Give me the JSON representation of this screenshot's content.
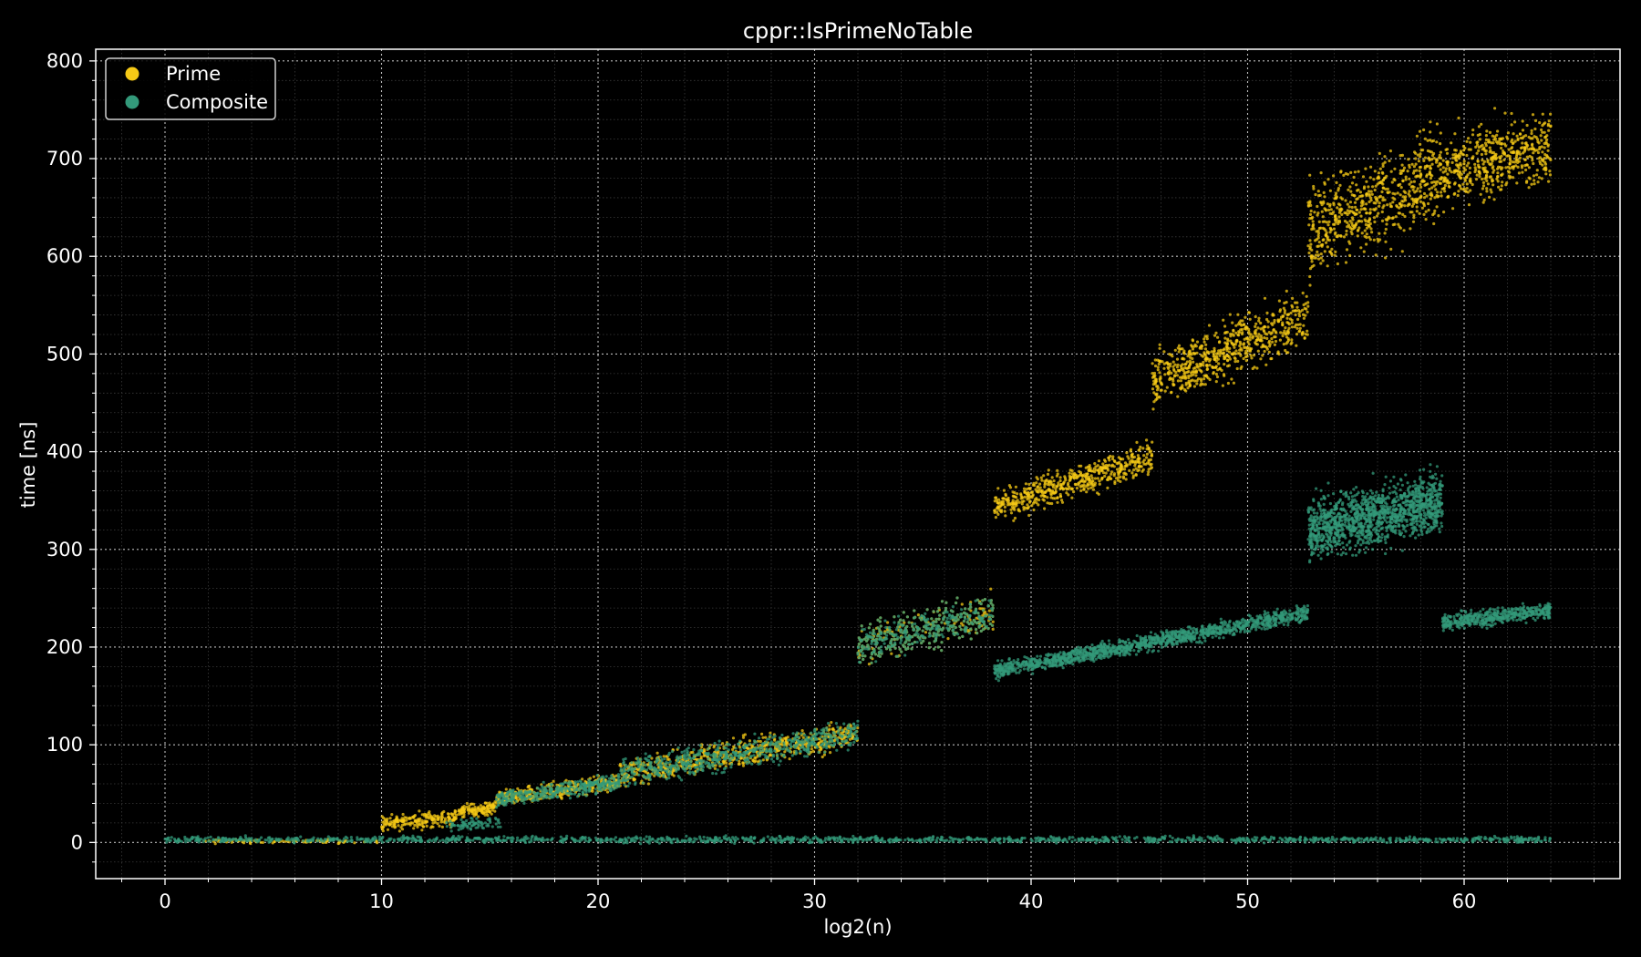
{
  "chart_data": {
    "type": "scatter",
    "title": "cppr::IsPrimeNoTable",
    "xlabel": "log2(n)",
    "ylabel": "time [ns]",
    "xlim": [
      -3.2,
      67.2
    ],
    "ylim": [
      -37,
      812
    ],
    "x_ticks": [
      0,
      10,
      20,
      30,
      40,
      50,
      60
    ],
    "y_ticks": [
      0,
      100,
      200,
      300,
      400,
      500,
      600,
      700,
      800
    ],
    "grid": true,
    "minor_grid": true,
    "legend_position": "top-left",
    "background": "#000000",
    "series": [
      {
        "name": "Prime",
        "color": "#f5c916",
        "bands": [
          {
            "x": [
              1.5,
              10
            ],
            "y": [
              1,
              1
            ],
            "spread": 1,
            "points": 80
          },
          {
            "x": [
              10,
              13.5
            ],
            "y": [
              20,
              25
            ],
            "spread": 4,
            "points": 200
          },
          {
            "x": [
              13.5,
              15.3
            ],
            "y": [
              32,
              36
            ],
            "spread": 3,
            "points": 120
          },
          {
            "x": [
              15.3,
              21
            ],
            "y": [
              44,
              62
            ],
            "spread": 4,
            "points": 350
          },
          {
            "x": [
              21,
              32
            ],
            "y": [
              70,
              112
            ],
            "spread": 7,
            "points": 650
          },
          {
            "x": [
              32,
              38.3
            ],
            "y": [
              202,
              236
            ],
            "spread": 10,
            "points": 400
          },
          {
            "x": [
              38.3,
              45.6
            ],
            "y": [
              342,
              395
            ],
            "spread": 8,
            "points": 550
          },
          {
            "x": [
              45.6,
              52.8
            ],
            "y": [
              470,
              540
            ],
            "spread": 14,
            "points": 650
          },
          {
            "x": [
              52.8,
              59
            ],
            "y": [
              625,
              685
            ],
            "spread": 22,
            "points": 650
          },
          {
            "x": [
              59,
              64
            ],
            "y": [
              685,
              715
            ],
            "spread": 18,
            "points": 500
          }
        ]
      },
      {
        "name": "Composite",
        "color": "#33997a",
        "bands": [
          {
            "x": [
              0,
              64
            ],
            "y": [
              3,
              3
            ],
            "spread": 1.5,
            "points": 1400
          },
          {
            "x": [
              13,
              15.5
            ],
            "y": [
              17,
              20
            ],
            "spread": 3,
            "points": 80
          },
          {
            "x": [
              15.3,
              21
            ],
            "y": [
              44,
              62
            ],
            "spread": 4,
            "points": 350
          },
          {
            "x": [
              21,
              32
            ],
            "y": [
              70,
              112
            ],
            "spread": 7,
            "points": 650
          },
          {
            "x": [
              32,
              38.3
            ],
            "y": [
              202,
              236
            ],
            "spread": 10,
            "points": 450
          },
          {
            "x": [
              38.3,
              52.8
            ],
            "y": [
              175,
              235
            ],
            "spread": 4,
            "points": 1300
          },
          {
            "x": [
              52.8,
              59
            ],
            "y": [
              320,
              350
            ],
            "spread": 15,
            "points": 1300
          },
          {
            "x": [
              59,
              64
            ],
            "y": [
              225,
              237
            ],
            "spread": 4,
            "points": 450
          }
        ]
      }
    ]
  }
}
